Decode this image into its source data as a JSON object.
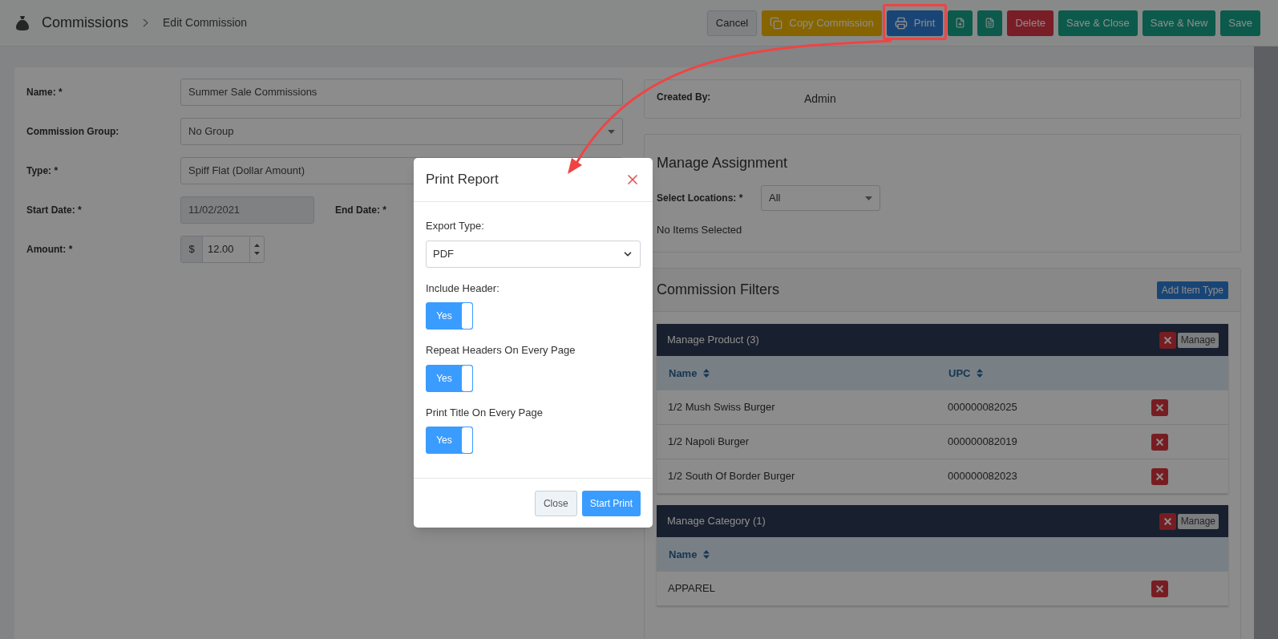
{
  "header": {
    "title": "Commissions",
    "breadcrumb": "Edit Commission"
  },
  "toolbar": [
    {
      "kind": "default",
      "label": "Cancel",
      "highlighted": false
    },
    {
      "kind": "copy",
      "label": "Copy Commission",
      "highlighted": false
    },
    {
      "kind": "print",
      "label": "Print",
      "highlighted": true
    },
    {
      "kind": "file-add",
      "highlighted": false
    },
    {
      "kind": "file",
      "highlighted": false
    },
    {
      "kind": "danger",
      "label": "Delete",
      "highlighted": false
    },
    {
      "kind": "success",
      "label": "Save & Close",
      "highlighted": false
    },
    {
      "kind": "success",
      "label": "Save & New",
      "highlighted": false
    },
    {
      "kind": "success",
      "label": "Save",
      "highlighted": false
    }
  ],
  "form": {
    "name": {
      "label": "Name: *",
      "value": "Summer Sale Commissions"
    },
    "group": {
      "label": "Commission Group:",
      "value": "No Group"
    },
    "type": {
      "label": "Type: *",
      "value": "Spiff Flat (Dollar Amount)"
    },
    "start_date": {
      "label": "Start Date: *",
      "value": "11/02/2021"
    },
    "end_date": {
      "label": "End Date: *"
    },
    "amount": {
      "label": "Amount: *",
      "prefix": "$",
      "value": "12.00"
    }
  },
  "created_by": {
    "label": "Created By:",
    "value": "Admin"
  },
  "assignment": {
    "title": "Manage Assignment",
    "locations_label": "Select Locations: *",
    "locations_value": "All",
    "empty_text": "No Items Selected"
  },
  "filters": {
    "title": "Commission Filters",
    "add_button": "Add Item Type",
    "groups": [
      {
        "title": "Manage Product (3)",
        "manage_button": "Manage",
        "columns": [
          "Name",
          "UPC"
        ],
        "rows": [
          [
            "1/2 Mush Swiss Burger",
            "000000082025"
          ],
          [
            "1/2 Napoli Burger",
            "000000082019"
          ],
          [
            "1/2 South Of Border Burger",
            "000000082023"
          ]
        ]
      },
      {
        "title": "Manage Category (1)",
        "manage_button": "Manage",
        "columns": [
          "Name"
        ],
        "rows": [
          [
            "APPAREL"
          ]
        ]
      }
    ]
  },
  "modal": {
    "title": "Print Report",
    "export_label": "Export Type:",
    "export_value": "PDF",
    "toggles": [
      {
        "label": "Include Header:",
        "text": "Yes",
        "on": true
      },
      {
        "label": "Repeat Headers On Every Page",
        "text": "Yes",
        "on": true
      },
      {
        "label": "Print Title On Every Page",
        "text": "Yes",
        "on": true
      }
    ],
    "buttons": [
      {
        "kind": "secondary",
        "label": "Close"
      },
      {
        "kind": "primary",
        "label": "Start Print"
      }
    ]
  }
}
